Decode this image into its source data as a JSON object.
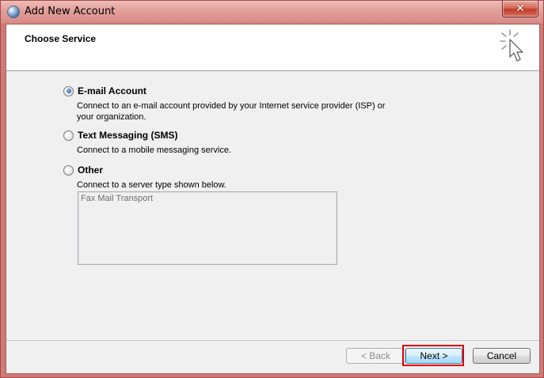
{
  "window": {
    "title": "Add New Account",
    "close_glyph": "✕"
  },
  "header": {
    "title": "Choose Service"
  },
  "options": [
    {
      "label": "E-mail Account",
      "description_line1": "Connect to an e-mail account provided by your Internet service provider (ISP) or",
      "description_line2": "your organization.",
      "selected": true
    },
    {
      "label": "Text Messaging (SMS)",
      "description_line1": "Connect to a mobile messaging service.",
      "selected": false
    },
    {
      "label": "Other",
      "description_line1": "Connect to a server type shown below.",
      "selected": false
    }
  ],
  "server_list": {
    "items": [
      "Fax Mail Transport"
    ]
  },
  "buttons": {
    "back": "< Back",
    "next": "Next >",
    "cancel": "Cancel"
  },
  "colors": {
    "highlight": "#e00000",
    "titlebar": "#e29f9a"
  },
  "icons": {
    "app": "outlook-app-icon",
    "wizard": "cursor-sparkle-icon",
    "close": "close-icon"
  }
}
